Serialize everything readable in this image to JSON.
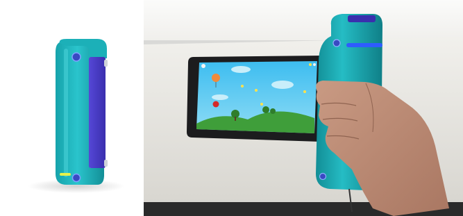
{
  "photos": [
    {
      "label": "handheld-device-product-photo"
    },
    {
      "label": "person-holding-device-tablet-game"
    }
  ],
  "colors": {
    "device_teal": "#1fb5bd",
    "device_teal_dark": "#148b93",
    "device_purple": "#4a3ec4",
    "led_blue": "#2f5cff",
    "led_yellow": "#e6f24a",
    "sky": "#58c9f0",
    "grass": "#3f9e3a",
    "table": "#ecebe6",
    "wall": "#ffffff",
    "skin": "#b88a73"
  }
}
